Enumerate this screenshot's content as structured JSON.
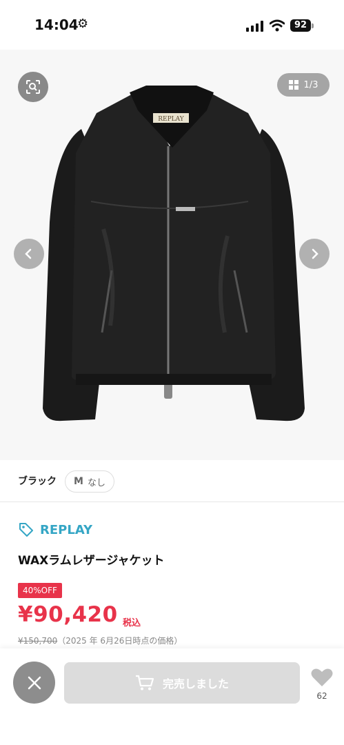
{
  "status_bar": {
    "time": "14:04",
    "battery": "92"
  },
  "gallery": {
    "counter_current": "1",
    "counter_sep": "/",
    "counter_total": "3"
  },
  "variant": {
    "color": "ブラック",
    "size_letter": "M",
    "size_stock": "なし"
  },
  "product": {
    "brand": "REPLAY",
    "title": "WAXラムレザージャケット",
    "discount": "40%OFF",
    "price": "¥90,420",
    "tax_label": "税込",
    "original_price": "¥150,700",
    "price_note": "（2025 年 6月26日時点の価格）"
  },
  "actions": {
    "sold_label": "完売しました",
    "like_count": "62"
  },
  "colors": {
    "accent_blue": "#35a6c5",
    "sale_red": "#e8334a",
    "disabled_gray": "#dcdcdc"
  }
}
